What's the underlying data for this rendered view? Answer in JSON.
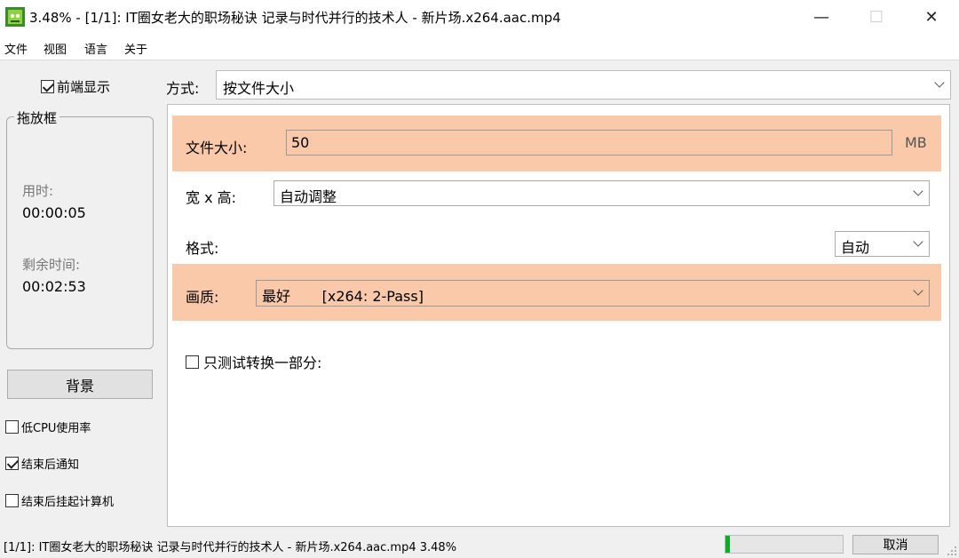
{
  "window": {
    "title": "3.48% - [1/1]: IT圈女老大的职场秘诀  记录与时代并行的技术人 - 新片场.x264.aac.mp4",
    "minimize_symbol": "—",
    "maximize_symbol": "☐",
    "close_symbol": "✕"
  },
  "menu": [
    "文件",
    "视图",
    "语言",
    "关于"
  ],
  "left_panel": {
    "topmost_label": "前端显示",
    "topmost_checked": true,
    "drag_frame_label": "拖放框",
    "elapsed_label": "用时:",
    "elapsed_value": "00:00:05",
    "remaining_label": "剩余时间:",
    "remaining_value": "00:02:53",
    "background_button": "背景",
    "options": [
      {
        "label": "低CPU使用率",
        "checked": false
      },
      {
        "label": "结束后通知",
        "checked": true
      },
      {
        "label": "结束后挂起计算机",
        "checked": false
      }
    ]
  },
  "method": {
    "label": "方式:",
    "value": "按文件大小"
  },
  "settings": {
    "file_size_label": "文件大小:",
    "file_size_value": "50",
    "file_size_unit": "MB",
    "resolution_label": "宽 x 高:",
    "resolution_value": "自动调整",
    "format_label": "格式:",
    "format_value": "自动",
    "quality_label": "画质:",
    "quality_value": "最好       [x264: 2-Pass]",
    "test_label": "只测试转换一部分:",
    "test_checked": false
  },
  "status": {
    "text": "[1/1]: IT圈女老大的职场秘诀  记录与时代并行的技术人 - 新片场.x264.aac.mp4  3.48%",
    "progress": 0.0348,
    "cancel_label": "取消"
  },
  "colors": {
    "highlight": "#f9c9aa",
    "progress": "#06b025"
  },
  "icons": {
    "app": "app-logo-icon",
    "dropdown": "chevron-down-icon",
    "checkbox": "checkbox-icon",
    "grip": "resize-grip-icon"
  }
}
